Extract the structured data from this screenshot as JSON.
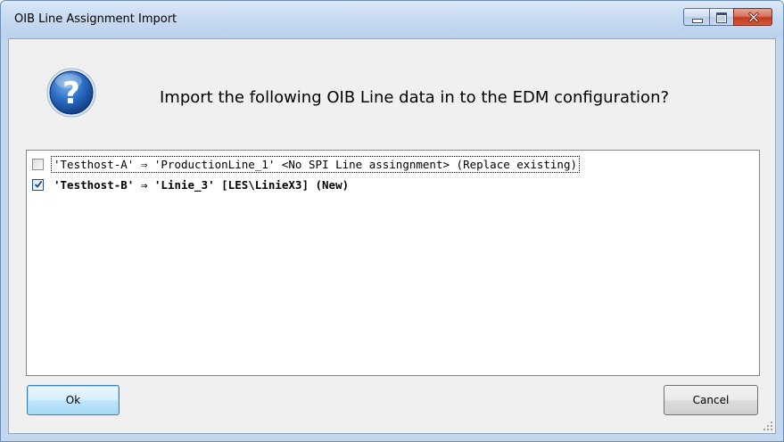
{
  "window": {
    "title": "OIB Line Assignment Import",
    "buttons": {
      "minimize": "minimize",
      "maximize": "maximize",
      "close": "close"
    }
  },
  "dialog": {
    "icon": "question-icon",
    "prompt": "Import the following OIB Line data in to the EDM configuration?"
  },
  "list": {
    "items": [
      {
        "text": "'Testhost-A' ⇒ 'ProductionLine_1' <No SPI Line assingnment> (Replace existing)",
        "checked": false,
        "focused": true,
        "bold": false
      },
      {
        "text": "'Testhost-B' ⇒ 'Linie_3' [LES\\LinieX3] (New)",
        "checked": true,
        "focused": false,
        "bold": true
      }
    ]
  },
  "footer": {
    "ok_label": "Ok",
    "cancel_label": "Cancel"
  },
  "colors": {
    "titlebar": "#c6d9f0",
    "client_bg": "#f0f0f0",
    "close_button": "#c43b1c",
    "default_button_border": "#3c7fb1"
  }
}
